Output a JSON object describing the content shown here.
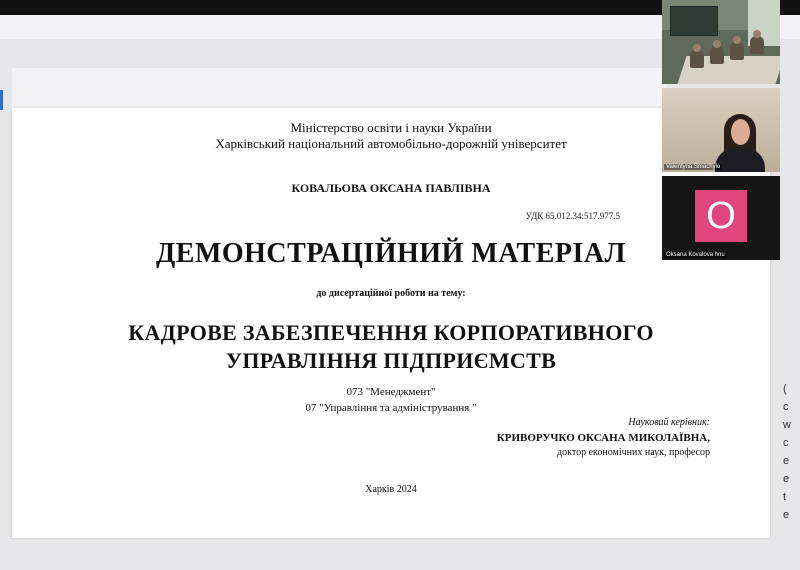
{
  "slide": {
    "ministry": "Міністерство освіти і науки України",
    "university": "Харківський національний автомобільно-дорожній університет",
    "author": "КОВАЛЬОВА ОКСАНА ПАВЛІВНА",
    "udk": "УДК 65.012.34:517.977.5",
    "title": "ДЕМОНСТРАЦІЙНИЙ МАТЕРІАЛ",
    "subtitle": "до дисертаційної роботи на тему:",
    "topic_line1": "КАДРОВЕ ЗАБЕЗПЕЧЕННЯ КОРПОРАТИВНОГО",
    "topic_line2": "УПРАВЛІННЯ ПІДПРИЄМСТВ",
    "specialty1": "073  \"Менеджмент\"",
    "specialty2": "07 \"Управління та адміністрування \"",
    "supervisor_label": "Науковий керівник:",
    "supervisor_name": "КРИВОРУЧКО ОКСАНА МИКОЛАЇВНА,",
    "supervisor_title": "доктор економічних наук, професор",
    "city_year": "Харків  2024"
  },
  "participants": [
    {
      "name": "",
      "kind": "room-camera"
    },
    {
      "name": "Valentyna Smachylo",
      "kind": "camera"
    },
    {
      "name": "Oksana Kovalova hnu",
      "kind": "avatar",
      "initial": "O",
      "color": "#e0457b"
    }
  ],
  "right_strip": [
    "(",
    "c",
    "w",
    "c",
    "e",
    "e",
    "t",
    "e"
  ]
}
